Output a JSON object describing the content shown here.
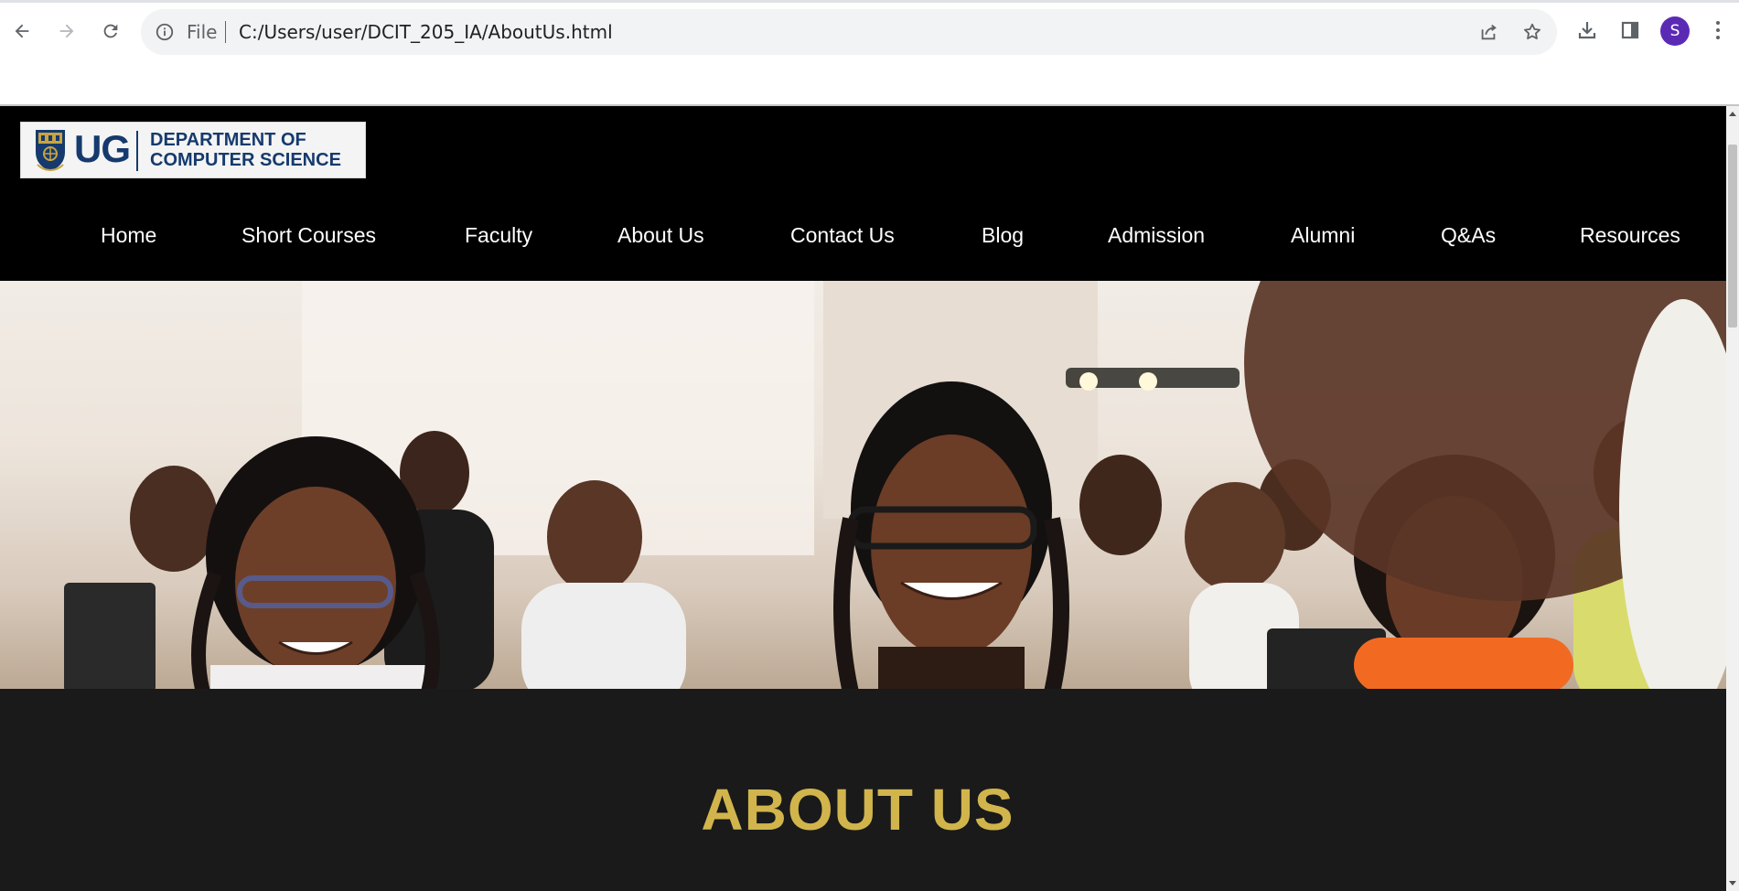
{
  "browser": {
    "address": {
      "scheme_label": "File",
      "url": "C:/Users/user/DCIT_205_IA/AboutUs.html"
    },
    "profile_initial": "S",
    "icons": [
      "back-icon",
      "forward-icon",
      "reload-icon",
      "info-icon",
      "share-icon",
      "bookmark-star-icon",
      "download-icon",
      "side-panel-icon",
      "menu-icon"
    ]
  },
  "site": {
    "logo": {
      "mark": "UG",
      "department": "DEPARTMENT OF\nCOMPUTER SCIENCE"
    },
    "nav": [
      {
        "label": "Home"
      },
      {
        "label": "Short Courses"
      },
      {
        "label": "Faculty"
      },
      {
        "label": "About Us"
      },
      {
        "label": "Contact Us"
      },
      {
        "label": "Blog"
      },
      {
        "label": "Admission"
      },
      {
        "label": "Alumni"
      },
      {
        "label": "Q&As"
      },
      {
        "label": "Resources"
      }
    ],
    "about_title": "ABOUT US"
  },
  "colors": {
    "header_bg": "#000000",
    "section_bg": "#1a1a1a",
    "accent_gold": "#d1b54c",
    "logo_blue": "#163a6d"
  }
}
